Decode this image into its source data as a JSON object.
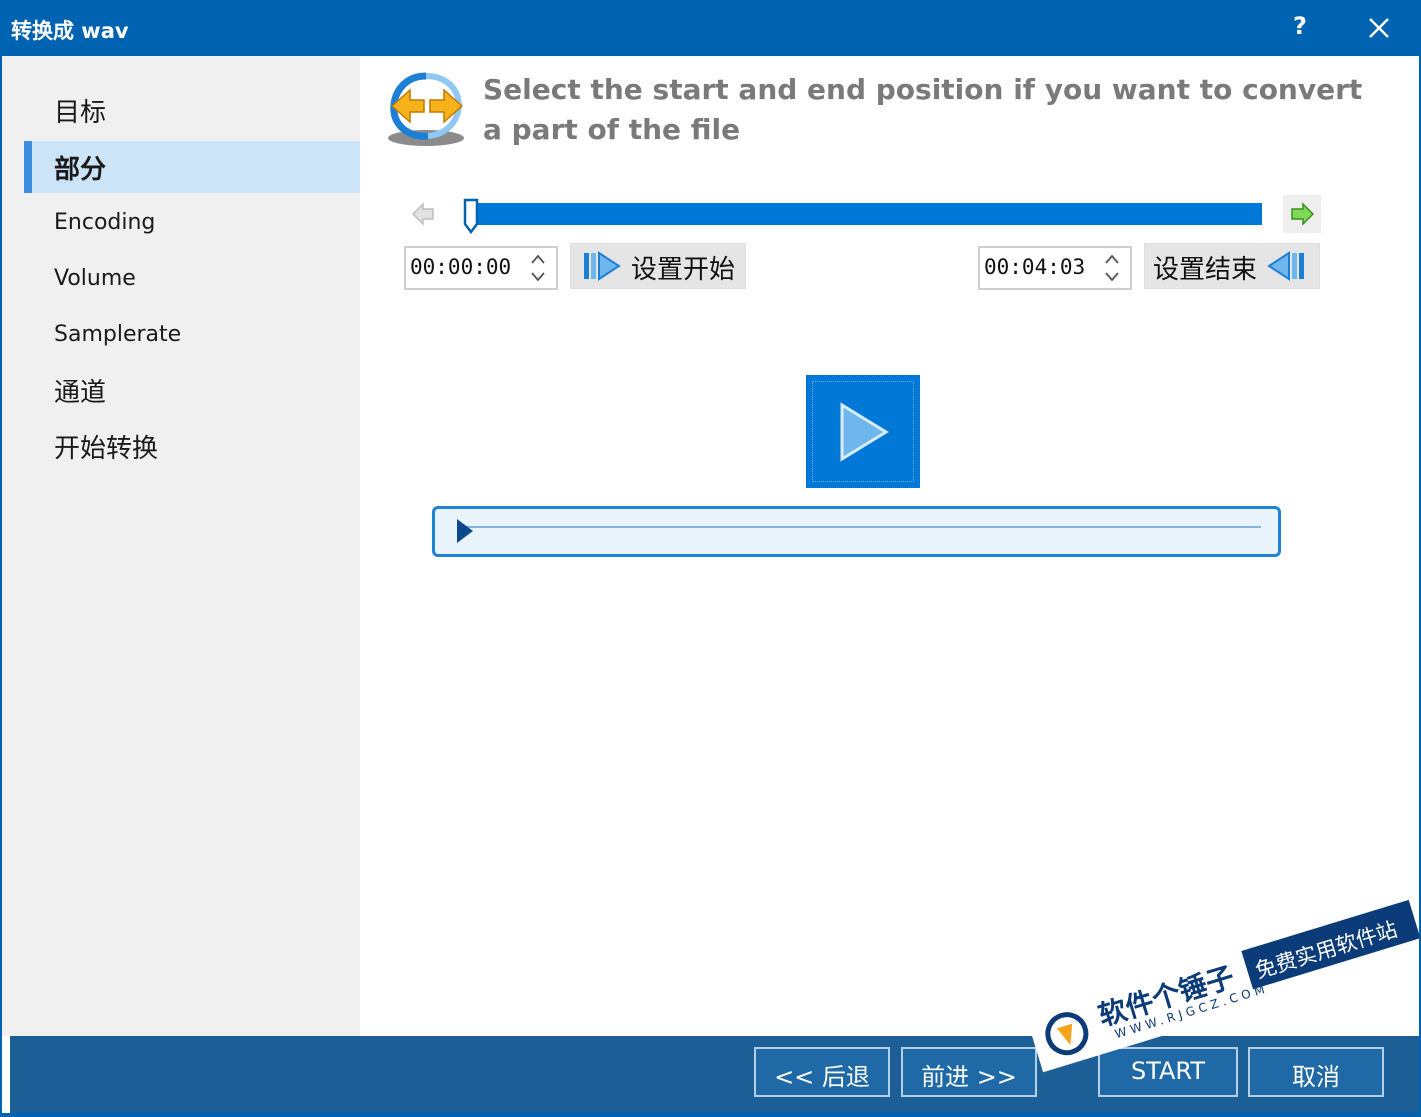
{
  "window": {
    "title": "转换成 wav",
    "help_label": "?",
    "title_bar_color": "#0063b1"
  },
  "sidebar": {
    "items": [
      {
        "label": "目标",
        "active": false
      },
      {
        "label": "部分",
        "active": true
      },
      {
        "label": "Encoding",
        "active": false
      },
      {
        "label": "Volume",
        "active": false
      },
      {
        "label": "Samplerate",
        "active": false
      },
      {
        "label": "通道",
        "active": false
      },
      {
        "label": "开始转换",
        "active": false
      }
    ]
  },
  "main": {
    "instruction": "Select the start and end position if you want to convert a part of the file",
    "header_icon": "convert-arrows-icon",
    "range": {
      "start_fraction": 0.0,
      "end_fraction": 1.0
    },
    "start_time": "00:00:00",
    "end_time": "00:04:03",
    "set_start_label": "设置开始",
    "set_end_label": "设置结束",
    "playback_fraction": 0.0
  },
  "footer": {
    "back_label": "<< 后退",
    "next_label": "前进 >>",
    "start_label": "START",
    "cancel_label": "取消"
  },
  "watermark": {
    "main": "软件个锤子",
    "url": "WWW.RJGCZ.COM",
    "tag": "免费实用软件站"
  },
  "colors": {
    "accent": "#0078d7",
    "footer": "#1c5e96",
    "sidebar_bg": "#f0f0f0",
    "sidebar_active": "#cce4f7"
  }
}
